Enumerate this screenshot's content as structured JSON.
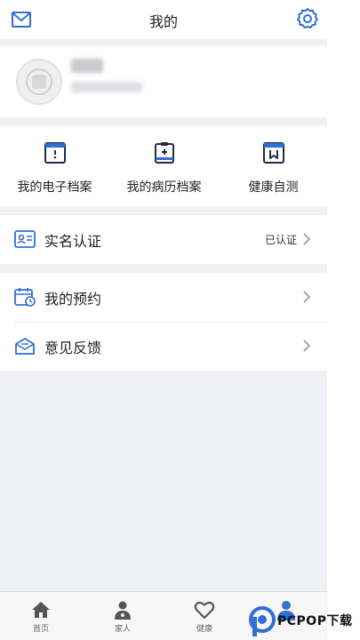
{
  "header": {
    "title": "我的"
  },
  "quick_actions": [
    {
      "label": "我的电子档案",
      "icon": "e-record-icon"
    },
    {
      "label": "我的病历档案",
      "icon": "medical-record-icon"
    },
    {
      "label": "健康自测",
      "icon": "health-test-icon"
    }
  ],
  "verification": {
    "label": "实名认证",
    "status": "已认证"
  },
  "menu": [
    {
      "label": "我的预约",
      "icon": "calendar-icon"
    },
    {
      "label": "意见反馈",
      "icon": "feedback-icon"
    }
  ],
  "tabs": [
    {
      "label": "首页",
      "icon": "home-icon"
    },
    {
      "label": "家人",
      "icon": "family-icon"
    },
    {
      "label": "健康",
      "icon": "heart-icon"
    }
  ],
  "watermark": {
    "text": "PCPOP下载"
  },
  "colors": {
    "accent": "#2f6fd6",
    "background": "#f0f1f5"
  }
}
